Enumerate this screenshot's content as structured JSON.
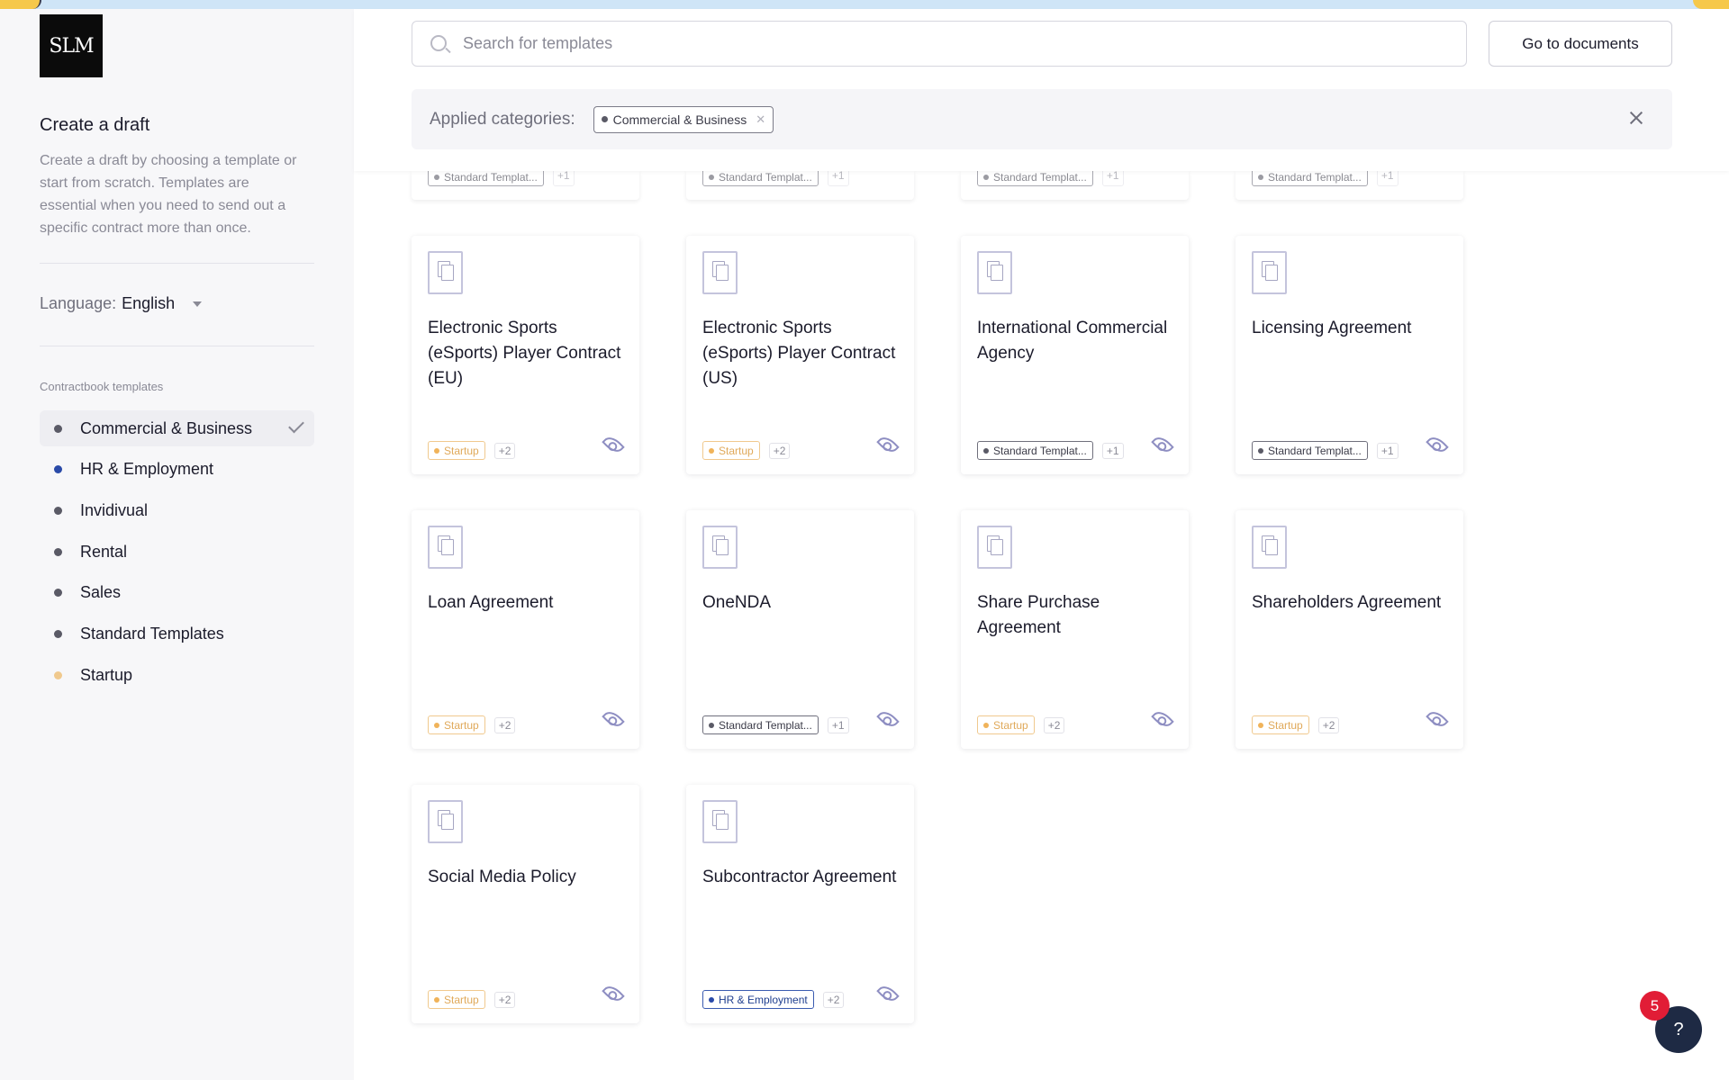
{
  "sidebar": {
    "logo_text": "SLM",
    "title": "Create a draft",
    "description": "Create a draft by choosing a template or start from scratch. Templates are essential when you need to send out a specific contract more than once.",
    "language_label": "Language:",
    "language_value": "English",
    "section_label": "Contractbook templates",
    "categories": [
      {
        "label": "Commercial & Business",
        "color": "#5a5a66",
        "selected": true
      },
      {
        "label": "HR & Employment",
        "color": "#2a4aa8"
      },
      {
        "label": "Invidivual",
        "color": "#5a5a66"
      },
      {
        "label": "Rental",
        "color": "#5a5a66"
      },
      {
        "label": "Sales",
        "color": "#5a5a66"
      },
      {
        "label": "Standard Templates",
        "color": "#5a5a66"
      },
      {
        "label": "Startup",
        "color": "#f0c98e"
      }
    ]
  },
  "header": {
    "search_placeholder": "Search for templates",
    "go_to_documents": "Go to documents",
    "applied_label": "Applied categories:",
    "applied_chip": "Commercial & Business"
  },
  "partial_row": {
    "tag": "Standard Templat...",
    "more": "+1"
  },
  "cards": [
    {
      "title": "Electronic Sports (eSports) Player Contract (EU)",
      "tag": "Startup",
      "tag_type": "startup",
      "more": "+2"
    },
    {
      "title": "Electronic Sports (eSports) Player Contract (US)",
      "tag": "Startup",
      "tag_type": "startup",
      "more": "+2"
    },
    {
      "title": "International Commercial Agency",
      "tag": "Standard Templat...",
      "tag_type": "standard",
      "more": "+1"
    },
    {
      "title": "Licensing Agreement",
      "tag": "Standard Templat...",
      "tag_type": "standard",
      "more": "+1"
    },
    {
      "title": "Loan Agreement",
      "tag": "Startup",
      "tag_type": "startup",
      "more": "+2"
    },
    {
      "title": "OneNDA",
      "tag": "Standard Templat...",
      "tag_type": "standard",
      "more": "+1"
    },
    {
      "title": "Share Purchase Agreement",
      "tag": "Startup",
      "tag_type": "startup",
      "more": "+2"
    },
    {
      "title": "Shareholders Agreement",
      "tag": "Startup",
      "tag_type": "startup",
      "more": "+2"
    },
    {
      "title": "Social Media Policy",
      "tag": "Startup",
      "tag_type": "startup",
      "more": "+2"
    },
    {
      "title": "Subcontractor Agreement",
      "tag": "HR & Employment",
      "tag_type": "hr",
      "more": "+2"
    }
  ],
  "help": {
    "label": "?",
    "badge": "5"
  }
}
